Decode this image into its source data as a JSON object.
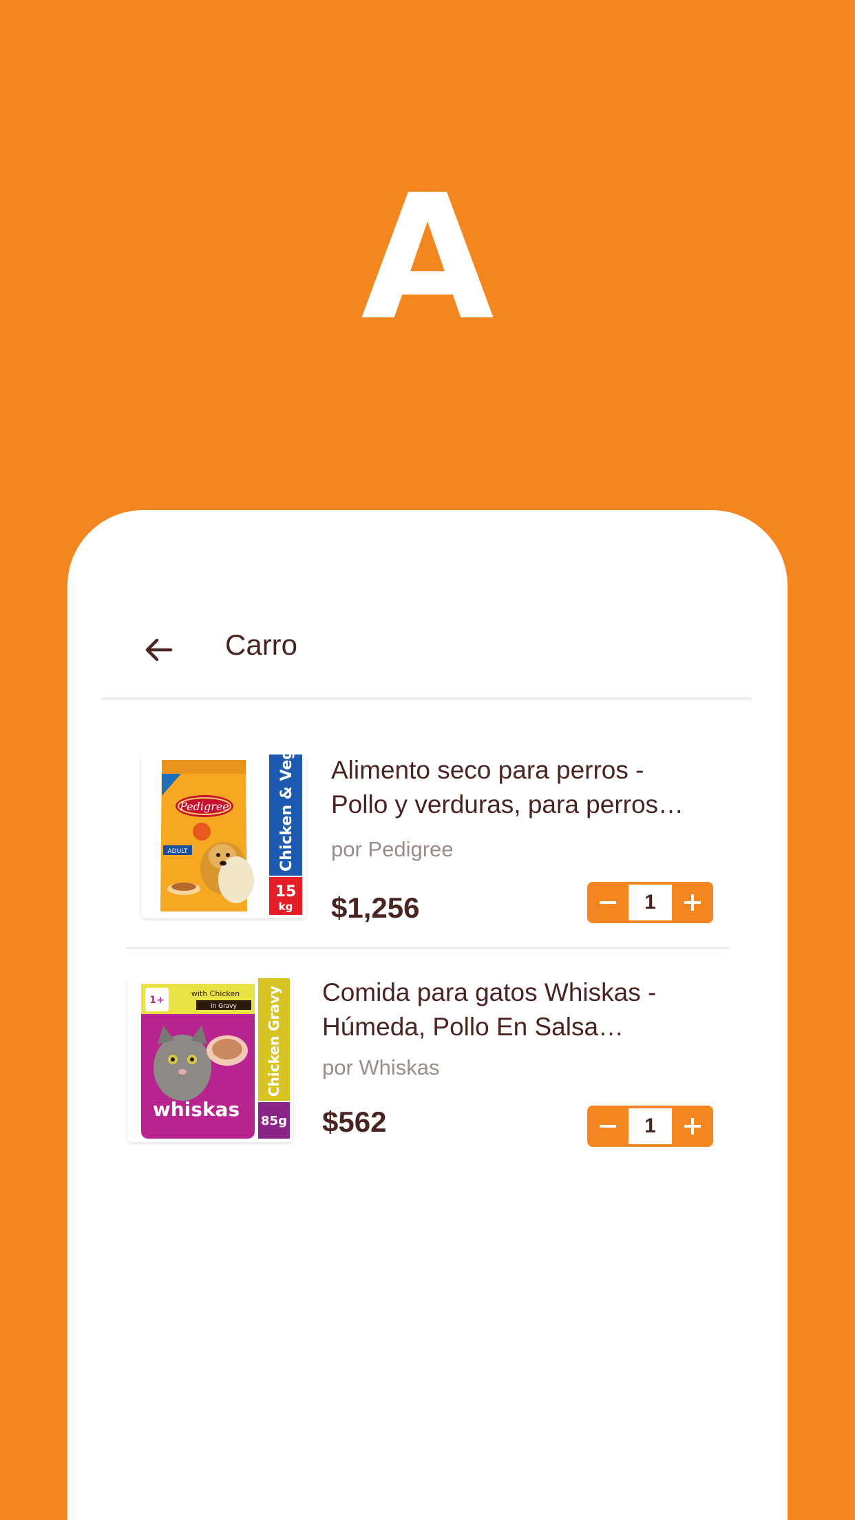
{
  "hero": {
    "letter": "A"
  },
  "colors": {
    "accent": "#F4861F",
    "text_primary": "#4a2420",
    "text_secondary": "#9a8c88"
  },
  "appbar": {
    "back_icon": "arrow-left-icon",
    "title": "Carro"
  },
  "cart": {
    "items": [
      {
        "title": "Alimento seco para perros - Pollo y verduras, para perros…",
        "brand": "por Pedigree",
        "price": "$1,256",
        "quantity": "1",
        "image": {
          "brand_text": "Pedigree",
          "stripe_text": "Chicken & Veg",
          "size_text_top": "15",
          "size_text_bottom": "kg",
          "badge_text": "ADULT"
        }
      },
      {
        "title": "Comida para gatos Whiskas - Húmeda, Pollo En Salsa…",
        "brand": "por Whiskas",
        "price": "$562",
        "quantity": "1",
        "image": {
          "brand_text": "whiskas",
          "stripe_text": "Chicken Gravy",
          "size_text": "85g",
          "tag_text_top": "with Chicken",
          "tag_text_bottom": "in Gravy",
          "age_text": "1+"
        }
      }
    ]
  }
}
